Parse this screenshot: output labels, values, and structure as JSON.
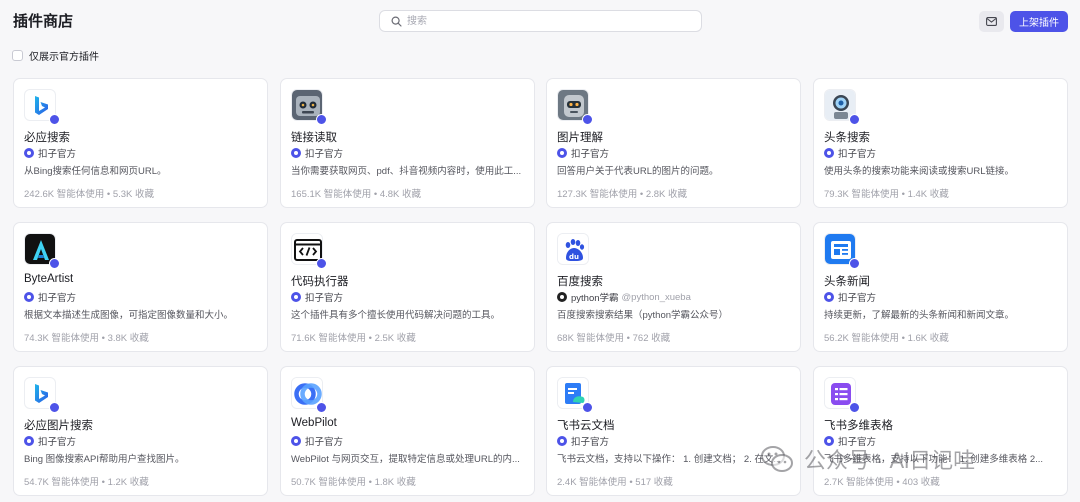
{
  "header": {
    "title": "插件商店",
    "search_placeholder": "搜索",
    "publish_label": "上架插件"
  },
  "filter": {
    "official_only_label": "仅展示官方插件",
    "checked": false
  },
  "plugins": [
    {
      "name": "必应搜索",
      "author": "扣子官方",
      "handle": "",
      "desc": "从Bing搜索任何信息和网页URL。",
      "stats": "242.6K 智能体使用 • 5.3K 收藏",
      "icon": "bing-icon"
    },
    {
      "name": "链接读取",
      "author": "扣子官方",
      "handle": "",
      "desc": "当你需要获取网页、pdf、抖音视频内容时，使用此工...",
      "stats": "165.1K 智能体使用 • 4.8K 收藏",
      "icon": "robot-link-icon"
    },
    {
      "name": "图片理解",
      "author": "扣子官方",
      "handle": "",
      "desc": "回答用户关于代表URL的图片的问题。",
      "stats": "127.3K 智能体使用 • 2.8K 收藏",
      "icon": "robot-vision-icon"
    },
    {
      "name": "头条搜索",
      "author": "扣子官方",
      "handle": "",
      "desc": "使用头条的搜索功能来阅读或搜索URL链接。",
      "stats": "79.3K 智能体使用 • 1.4K 收藏",
      "icon": "robot-search-icon"
    },
    {
      "name": "ByteArtist",
      "author": "扣子官方",
      "handle": "",
      "desc": "根据文本描述生成图像，可指定图像数量和大小。",
      "stats": "74.3K 智能体使用 • 3.8K 收藏",
      "icon": "byteartist-icon"
    },
    {
      "name": "代码执行器",
      "author": "扣子官方",
      "handle": "",
      "desc": "这个插件具有多个擅长使用代码解决问题的工具。",
      "stats": "71.6K 智能体使用 • 2.5K 收藏",
      "icon": "code-window-icon"
    },
    {
      "name": "百度搜索",
      "author": "python学霸",
      "handle": "@python_xueba",
      "desc": "百度搜索搜索结果（python学霸公众号）",
      "stats": "68K 智能体使用 • 762 收藏",
      "icon": "baidu-icon"
    },
    {
      "name": "头条新闻",
      "author": "扣子官方",
      "handle": "",
      "desc": "持续更新，了解最新的头条新闻和新闻文章。",
      "stats": "56.2K 智能体使用 • 1.6K 收藏",
      "icon": "news-icon"
    },
    {
      "name": "必应图片搜索",
      "author": "扣子官方",
      "handle": "",
      "desc": "Bing 图像搜索API帮助用户查找图片。",
      "stats": "54.7K 智能体使用 • 1.2K 收藏",
      "icon": "bing-icon"
    },
    {
      "name": "WebPilot",
      "author": "扣子官方",
      "handle": "",
      "desc": "WebPilot 与网页交互，提取特定信息或处理URL的内...",
      "stats": "50.7K 智能体使用 • 1.8K 收藏",
      "icon": "webpilot-icon"
    },
    {
      "name": "飞书云文档",
      "author": "扣子官方",
      "handle": "",
      "desc": "飞书云文档，支持以下操作： 1. 创建文档； 2. 在文...",
      "stats": "2.4K 智能体使用 • 517 收藏",
      "icon": "feishu-doc-icon"
    },
    {
      "name": "飞书多维表格",
      "author": "扣子官方",
      "handle": "",
      "desc": "飞书多维表格，支持以下功能： 1. 创建多维表格 2...",
      "stats": "2.7K 智能体使用 • 403 收藏",
      "icon": "feishu-bitable-icon"
    }
  ],
  "watermark": "公众号 · Ai日记哇",
  "colors": {
    "accent": "#4d53e8",
    "background": "#f7f7f9"
  }
}
